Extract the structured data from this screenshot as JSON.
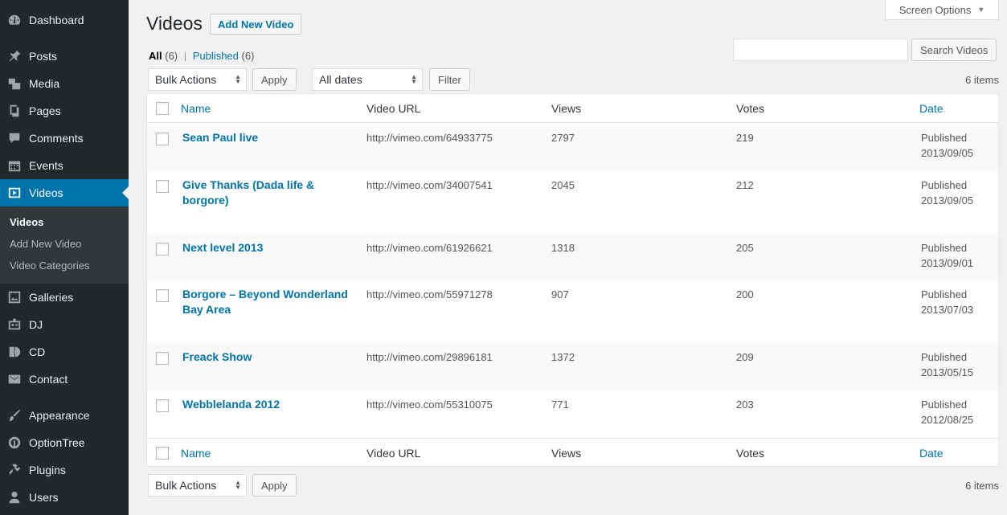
{
  "sidebar": {
    "items": [
      {
        "label": "Dashboard",
        "icon": "dashboard-icon"
      },
      {
        "label": "Posts",
        "icon": "pin-icon"
      },
      {
        "label": "Media",
        "icon": "media-icon"
      },
      {
        "label": "Pages",
        "icon": "pages-icon"
      },
      {
        "label": "Comments",
        "icon": "comment-icon"
      },
      {
        "label": "Events",
        "icon": "calendar-icon"
      },
      {
        "label": "Videos",
        "icon": "video-icon"
      },
      {
        "label": "Galleries",
        "icon": "gallery-icon"
      },
      {
        "label": "DJ",
        "icon": "id-card-icon"
      },
      {
        "label": "CD",
        "icon": "cd-icon"
      },
      {
        "label": "Contact",
        "icon": "envelope-icon"
      },
      {
        "label": "Appearance",
        "icon": "paintbrush-icon"
      },
      {
        "label": "OptionTree",
        "icon": "optiontree-icon"
      },
      {
        "label": "Plugins",
        "icon": "plug-icon"
      },
      {
        "label": "Users",
        "icon": "user-icon"
      }
    ],
    "submenu": [
      "Videos",
      "Add New Video",
      "Video Categories"
    ],
    "active_color": "#0073aa"
  },
  "header": {
    "title": "Videos",
    "add_new": "Add New Video",
    "screen_options": "Screen Options"
  },
  "filters": {
    "all_label": "All",
    "all_count": "(6)",
    "separator": "|",
    "published_label": "Published",
    "published_count": "(6)"
  },
  "search": {
    "value": "",
    "button": "Search Videos"
  },
  "toolbar": {
    "bulk_actions": "Bulk Actions",
    "apply": "Apply",
    "dates": "All dates",
    "filter": "Filter",
    "items_count": "6 items"
  },
  "table": {
    "columns": [
      "Name",
      "Video URL",
      "Views",
      "Votes",
      "Date"
    ],
    "rows": [
      {
        "name": "Sean Paul live",
        "url": "http://vimeo.com/64933775",
        "views": "2797",
        "votes": "219",
        "status": "Published",
        "date": "2013/09/05"
      },
      {
        "name": "Give Thanks (Dada life & borgore)",
        "url": "http://vimeo.com/34007541",
        "views": "2045",
        "votes": "212",
        "status": "Published",
        "date": "2013/09/05"
      },
      {
        "name": "Next level 2013",
        "url": "http://vimeo.com/61926621",
        "views": "1318",
        "votes": "205",
        "status": "Published",
        "date": "2013/09/01"
      },
      {
        "name": "Borgore – Beyond Wonderland Bay Area",
        "url": "http://vimeo.com/55971278",
        "views": "907",
        "votes": "200",
        "status": "Published",
        "date": "2013/07/03"
      },
      {
        "name": "Freack Show",
        "url": "http://vimeo.com/29896181",
        "views": "1372",
        "votes": "209",
        "status": "Published",
        "date": "2013/05/15"
      },
      {
        "name": "Webblelanda 2012",
        "url": "http://vimeo.com/55310075",
        "views": "771",
        "votes": "203",
        "status": "Published",
        "date": "2012/08/25"
      }
    ]
  }
}
